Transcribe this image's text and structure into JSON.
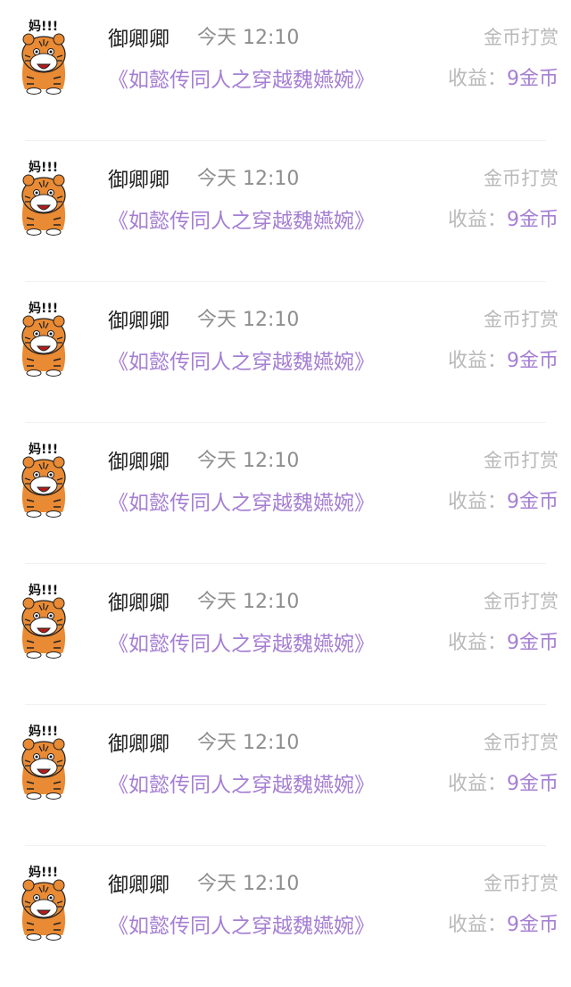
{
  "colors": {
    "background": "#ffffff",
    "name_text": "#222222",
    "time_text": "#8e8e8e",
    "muted_text": "#b9b9b9",
    "accent_purple": "#a57fd3",
    "divider": "#f1f1f1"
  },
  "avatar_icon": "tiger-sticker-icon",
  "avatar_text": "妈!!!",
  "records": [
    {
      "name": "御卿卿",
      "time": "今天 12:10",
      "type": "金币打赏",
      "book": "《如懿传同人之穿越魏嬿婉》",
      "income_label": "收益：",
      "income_value": "9金币"
    },
    {
      "name": "御卿卿",
      "time": "今天 12:10",
      "type": "金币打赏",
      "book": "《如懿传同人之穿越魏嬿婉》",
      "income_label": "收益：",
      "income_value": "9金币"
    },
    {
      "name": "御卿卿",
      "time": "今天 12:10",
      "type": "金币打赏",
      "book": "《如懿传同人之穿越魏嬿婉》",
      "income_label": "收益：",
      "income_value": "9金币"
    },
    {
      "name": "御卿卿",
      "time": "今天 12:10",
      "type": "金币打赏",
      "book": "《如懿传同人之穿越魏嬿婉》",
      "income_label": "收益：",
      "income_value": "9金币"
    },
    {
      "name": "御卿卿",
      "time": "今天 12:10",
      "type": "金币打赏",
      "book": "《如懿传同人之穿越魏嬿婉》",
      "income_label": "收益：",
      "income_value": "9金币"
    },
    {
      "name": "御卿卿",
      "time": "今天 12:10",
      "type": "金币打赏",
      "book": "《如懿传同人之穿越魏嬿婉》",
      "income_label": "收益：",
      "income_value": "9金币"
    },
    {
      "name": "御卿卿",
      "time": "今天 12:10",
      "type": "金币打赏",
      "book": "《如懿传同人之穿越魏嬿婉》",
      "income_label": "收益：",
      "income_value": "9金币"
    }
  ]
}
